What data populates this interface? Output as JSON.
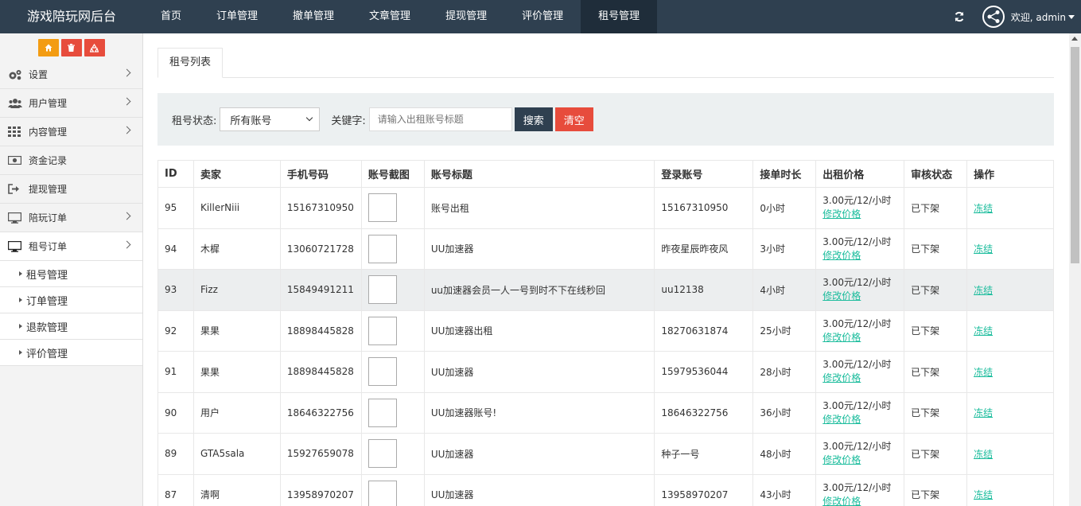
{
  "app": {
    "title": "游戏陪玩网后台"
  },
  "nav": {
    "items": [
      "首页",
      "订单管理",
      "撤单管理",
      "文章管理",
      "提现管理",
      "评价管理",
      "租号管理"
    ],
    "active_index": 6
  },
  "user": {
    "welcome": "欢迎, admin"
  },
  "quick_buttons": {
    "home_icon": "home-icon",
    "trash_icon": "trash-icon",
    "recycle_icon": "recycle-icon"
  },
  "sidebar": {
    "items": [
      {
        "label": "设置",
        "icon": "gears-icon"
      },
      {
        "label": "用户管理",
        "icon": "users-icon"
      },
      {
        "label": "内容管理",
        "icon": "grid-icon"
      },
      {
        "label": "资金记录",
        "icon": "money-icon"
      },
      {
        "label": "提现管理",
        "icon": "sign-out-icon"
      },
      {
        "label": "陪玩订单",
        "icon": "desktop-icon"
      },
      {
        "label": "租号订单",
        "icon": "desktop-icon"
      }
    ],
    "sub_items": [
      "租号管理",
      "订单管理",
      "退款管理",
      "评价管理"
    ]
  },
  "tab": {
    "label": "租号列表"
  },
  "search": {
    "status_label": "租号状态:",
    "status_value": "所有账号",
    "keyword_label": "关键字:",
    "keyword_placeholder": "请输入出租账号标题",
    "search_button": "搜索",
    "clear_button": "清空"
  },
  "table": {
    "headers": [
      "ID",
      "卖家",
      "手机号码",
      "账号截图",
      "账号标题",
      "登录账号",
      "接单时长",
      "出租价格",
      "审核状态",
      "操作"
    ],
    "price_link": "修改价格",
    "op_link": "冻结",
    "rows": [
      {
        "id": "95",
        "seller": "KillerNiii",
        "phone": "15167310950",
        "title": "账号出租",
        "login": "15167310950",
        "duration": "0小时",
        "price": "3.00元/12/小时",
        "status": "已下架"
      },
      {
        "id": "94",
        "seller": "木樨",
        "phone": "13060721728",
        "title": "UU加速器",
        "login": "昨夜星辰昨夜风",
        "duration": "3小时",
        "price": "3.00元/12/小时",
        "status": "已下架"
      },
      {
        "id": "93",
        "seller": "Fizz",
        "phone": "15849491211",
        "title": "uu加速器会员一人一号到时不下在线秒回",
        "login": "uu12138",
        "duration": "4小时",
        "price": "3.00元/12/小时",
        "status": "已下架"
      },
      {
        "id": "92",
        "seller": "果果",
        "phone": "18898445828",
        "title": "UU加速器出租",
        "login": "18270631874",
        "duration": "25小时",
        "price": "3.00元/12/小时",
        "status": "已下架"
      },
      {
        "id": "91",
        "seller": "果果",
        "phone": "18898445828",
        "title": "UU加速器",
        "login": "15979536044",
        "duration": "28小时",
        "price": "3.00元/12/小时",
        "status": "已下架"
      },
      {
        "id": "90",
        "seller": "用户",
        "phone": "18646322756",
        "title": "UU加速器账号!",
        "login": "18646322756",
        "duration": "36小时",
        "price": "3.00元/12/小时",
        "status": "已下架"
      },
      {
        "id": "89",
        "seller": "GTA5sala",
        "phone": "15927659078",
        "title": "UU加速器",
        "login": "种子一号",
        "duration": "48小时",
        "price": "3.00元/12/小时",
        "status": "已下架"
      },
      {
        "id": "87",
        "seller": "清啊",
        "phone": "13958970207",
        "title": "UU加速器",
        "login": "13958970207",
        "duration": "43小时",
        "price": "3.00元/12/小时",
        "status": "已下架"
      }
    ],
    "highlight_row_index": 2
  },
  "colors": {
    "topbar": "#2f4050",
    "link": "#1abc9c",
    "danger": "#e74c3c",
    "warning": "#f39c12"
  }
}
